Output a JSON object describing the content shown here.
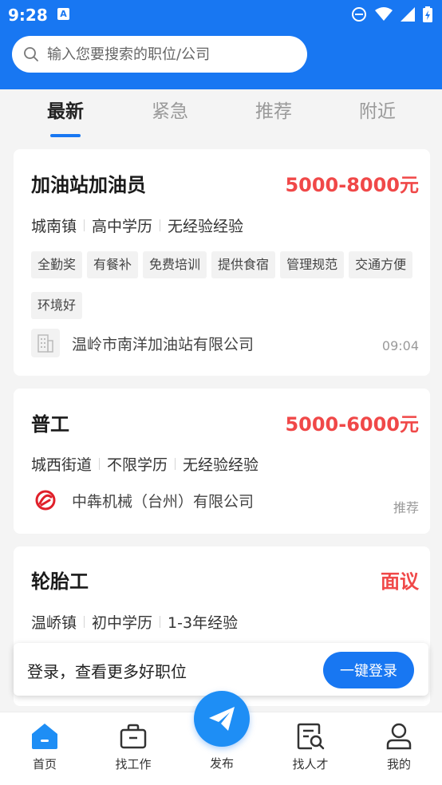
{
  "status_bar": {
    "time": "9:28",
    "notif_letter": "A"
  },
  "search": {
    "placeholder": "输入您要搜索的职位/公司"
  },
  "tabs": [
    {
      "label": "最新",
      "active": true
    },
    {
      "label": "紧急"
    },
    {
      "label": "推荐"
    },
    {
      "label": "附近"
    }
  ],
  "jobs": [
    {
      "title": "加油站加油员",
      "salary": "5000-8000元",
      "meta": [
        "城南镇",
        "高中学历",
        "无经验经验"
      ],
      "tags": [
        "全勤奖",
        "有餐补",
        "免费培训",
        "提供食宿",
        "管理规范",
        "交通方便",
        "环境好"
      ],
      "company": "温岭市南洋加油站有限公司",
      "right_note": "09:04"
    },
    {
      "title": "普工",
      "salary": "5000-6000元",
      "meta": [
        "城西街道",
        "不限学历",
        "无经验经验"
      ],
      "company": "中犇机械（台州）有限公司",
      "right_note": "推荐"
    },
    {
      "title": "轮胎工",
      "salary": "面议",
      "meta": [
        "温峤镇",
        "初中学历",
        "1-3年经验"
      ]
    }
  ],
  "login_banner": {
    "text": "登录，查看更多好职位",
    "button": "一键登录"
  },
  "bottom_nav": {
    "home": "首页",
    "find_job": "找工作",
    "publish": "发布",
    "find_talent": "找人才",
    "mine": "我的"
  },
  "colors": {
    "primary": "#1877f2",
    "salary": "#f04848"
  }
}
